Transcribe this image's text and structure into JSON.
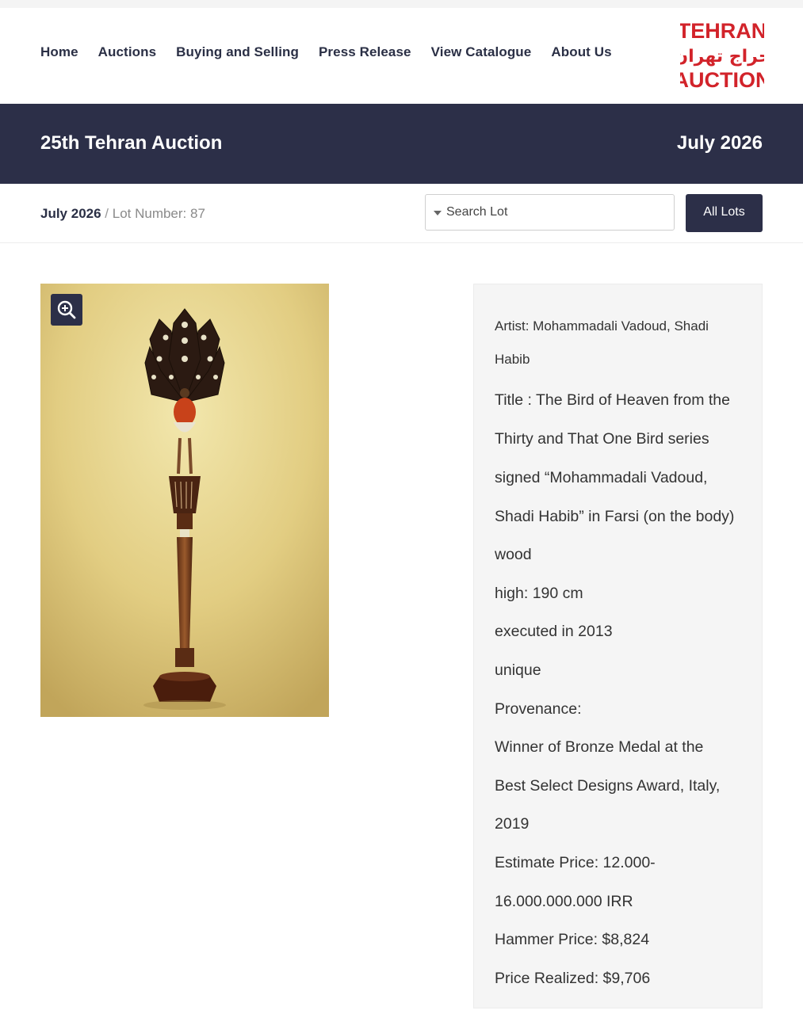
{
  "nav": {
    "items": [
      "Home",
      "Auctions",
      "Buying and Selling",
      "Press Release",
      "View Catalogue",
      "About Us"
    ]
  },
  "logo": {
    "line1": "TEHRAN",
    "line2": "حراج تهران",
    "line3": "AUCTION",
    "color": "#d2232a"
  },
  "banner": {
    "title": "25th Tehran Auction",
    "date": "July 2026",
    "bg_color": "#2c2f48"
  },
  "breadcrumb": {
    "current": "July 2026",
    "separator": " / ",
    "lot": "Lot Number: 87"
  },
  "search": {
    "placeholder": "Search Lot",
    "button": "All Lots"
  },
  "icons": {
    "zoom": "zoom-in-icon",
    "dropdown": "caret-down-icon"
  },
  "lot": {
    "artist_lines": [
      "Artist: Mohammadali Vadoud, Shadi",
      "Habib"
    ],
    "lines": [
      "Title : The Bird of Heaven from the",
      "Thirty and That One Bird series",
      "signed “Mohammadali Vadoud,",
      "Shadi Habib” in Farsi (on the body)",
      "wood",
      "high: 190 cm",
      "executed in 2013",
      "unique",
      "Provenance:",
      "Winner of Bronze Medal at the",
      "Best Select Designs Award, Italy,",
      "2019",
      "Estimate Price: 12.000-",
      "16.000.000.000 IRR",
      "Hammer Price: $8,824",
      "Price Realized: $9,706"
    ]
  }
}
